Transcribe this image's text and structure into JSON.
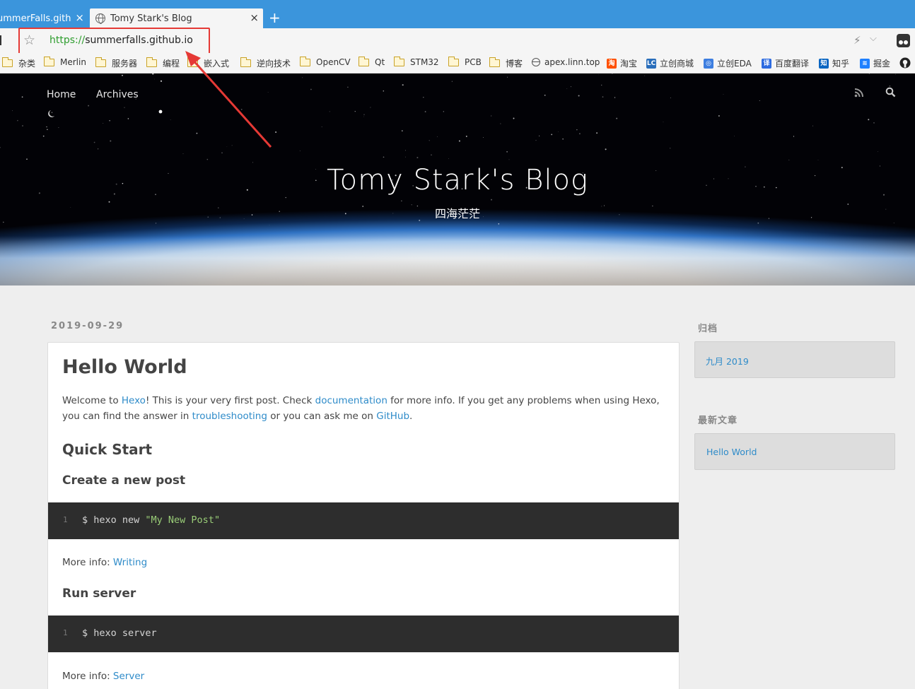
{
  "browser": {
    "tabs": [
      {
        "title": "ummerFalls.github.io",
        "active": false
      },
      {
        "title": "Tomy Stark's Blog",
        "active": true
      }
    ],
    "tab_close": "×",
    "new_tab": "+",
    "address": {
      "protocol": "https://",
      "host": "summerfalls.github.io"
    },
    "bookmarks": [
      {
        "label": "杂类",
        "icon": "folder-icon"
      },
      {
        "label": "Merlin",
        "icon": "folder-icon"
      },
      {
        "label": "服务器",
        "icon": "folder-icon"
      },
      {
        "label": "编程",
        "icon": "folder-icon"
      },
      {
        "label": "嵌入式",
        "icon": "folder-icon"
      },
      {
        "label": "逆向技术",
        "icon": "folder-icon"
      },
      {
        "label": "OpenCV",
        "icon": "folder-icon"
      },
      {
        "label": "Qt",
        "icon": "folder-icon"
      },
      {
        "label": "STM32",
        "icon": "folder-icon"
      },
      {
        "label": "PCB",
        "icon": "folder-icon"
      },
      {
        "label": "博客",
        "icon": "folder-icon"
      },
      {
        "label": "apex.linn.top",
        "icon": "globe-icon"
      },
      {
        "label": "淘宝",
        "icon": "taobao-icon",
        "glyph": "淘",
        "color": "#ff5000"
      },
      {
        "label": "立创商城",
        "icon": "lcsc-icon",
        "glyph": "LC",
        "color": "#2a6ebb"
      },
      {
        "label": "立创EDA",
        "icon": "lceda-icon",
        "glyph": "◎",
        "color": "#3d7ee0"
      },
      {
        "label": "百度翻译",
        "icon": "baidu-translate-icon",
        "glyph": "译",
        "color": "#2d6be0"
      },
      {
        "label": "知乎",
        "icon": "zhihu-icon",
        "glyph": "知",
        "color": "#0a66c2"
      },
      {
        "label": "掘金",
        "icon": "juejin-icon",
        "glyph": "≋",
        "color": "#1e80ff"
      }
    ]
  },
  "site": {
    "nav": [
      {
        "label": "Home"
      },
      {
        "label": "Archives"
      }
    ],
    "title": "Tomy Stark's Blog",
    "subtitle": "四海茫茫"
  },
  "post": {
    "date": "2019-09-29",
    "title": "Hello World",
    "intro": {
      "t1": "Welcome to ",
      "link1": "Hexo",
      "t2": "! This is your very first post. Check ",
      "link2": "documentation",
      "t3": " for more info. If you get any problems when using Hexo, you can find the answer in ",
      "link3": "troubleshooting",
      "t4": " or you can ask me on ",
      "link4": "GitHub",
      "t5": "."
    },
    "h2": "Quick Start",
    "sections": [
      {
        "heading": "Create a new post",
        "line_no": "1",
        "cmd": "$ hexo new ",
        "str": "\"My New Post\"",
        "more_label": "More info: ",
        "more_link": "Writing"
      },
      {
        "heading": "Run server",
        "line_no": "1",
        "cmd": "$ hexo server",
        "str": "",
        "more_label": "More info: ",
        "more_link": "Server"
      }
    ]
  },
  "sidebar": {
    "archive": {
      "title": "归档",
      "item": "九月 2019"
    },
    "recent": {
      "title": "最新文章",
      "item": "Hello World"
    }
  },
  "colors": {
    "link": "#2e8bc9",
    "tabbar": "#3b95dc",
    "highlight": "#e53935",
    "code_bg": "#2d2d2d"
  }
}
